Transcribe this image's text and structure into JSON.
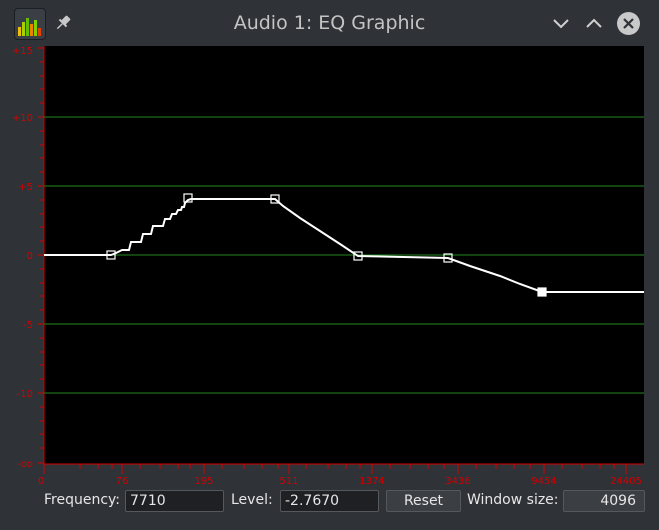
{
  "window": {
    "title": "Audio 1: EQ Graphic",
    "icons": [
      "eq-app-icon",
      "pin-icon",
      "minimize-icon",
      "maximize-icon",
      "close-icon"
    ]
  },
  "colors": {
    "axis_label": "#d40000",
    "grid": "#1f8a1f",
    "curve": "#ffffff",
    "background": "#000000"
  },
  "graph": {
    "y_labels": [
      "+15",
      "+10",
      "+5",
      "0",
      "-5",
      "-10",
      "-oo"
    ],
    "x_labels": [
      "0",
      "76",
      "195",
      "511",
      "1374",
      "3436",
      "9454",
      "24405"
    ]
  },
  "controls": {
    "frequency_label": "Frequency:",
    "frequency_value": "7710",
    "level_label": "Level:",
    "level_value": "-2.7670",
    "reset_label": "Reset",
    "window_size_label": "Window size:",
    "window_size_value": "4096"
  }
}
